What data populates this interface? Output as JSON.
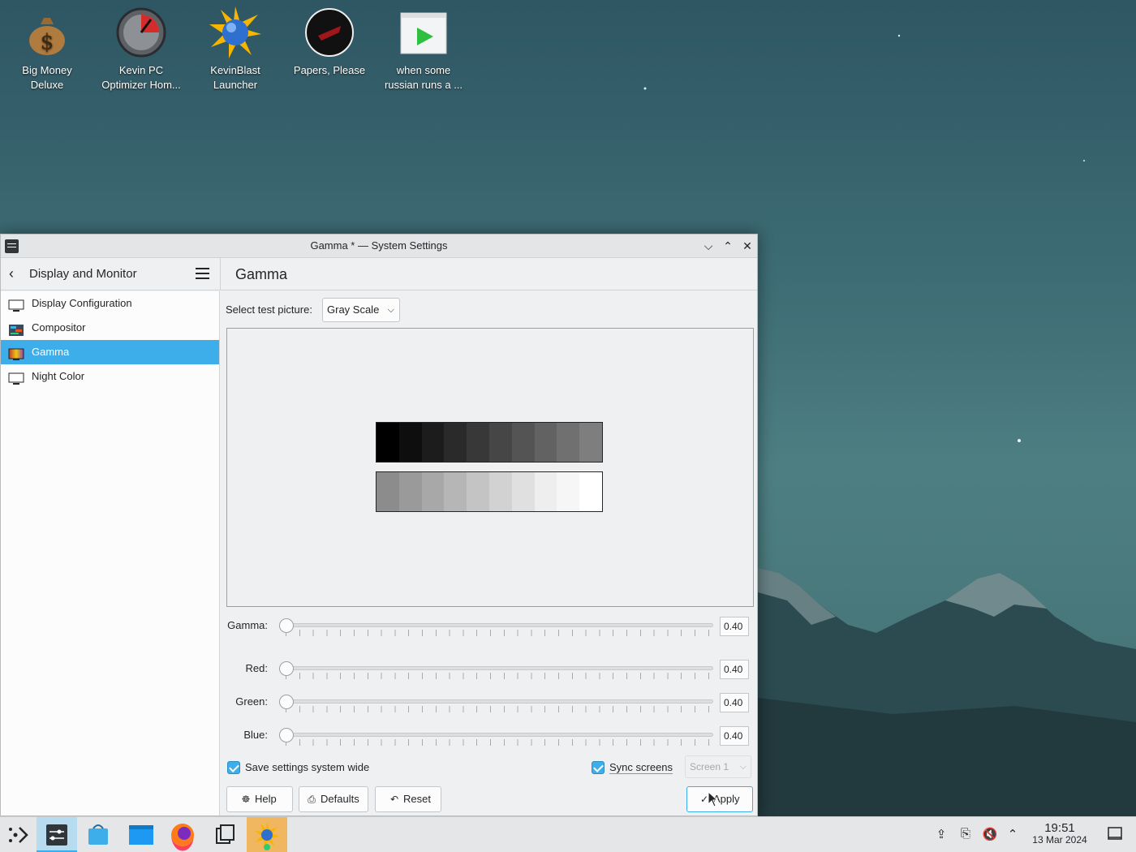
{
  "desktop": {
    "icons": [
      {
        "line1": "Big Money",
        "line2": "Deluxe",
        "icon": "money-bag-icon"
      },
      {
        "line1": "Kevin PC",
        "line2": "Optimizer Hom...",
        "icon": "speedometer-icon"
      },
      {
        "line1": "KevinBlast",
        "line2": "Launcher",
        "icon": "starburst-globe-icon"
      },
      {
        "line1": "Papers, Please",
        "line2": "",
        "icon": "papers-please-icon"
      },
      {
        "line1": "when some",
        "line2": "russian runs a ...",
        "icon": "video-play-icon"
      }
    ]
  },
  "window": {
    "title": "Gamma * — System Settings",
    "header": {
      "breadcrumb": "Display and Monitor",
      "page_title": "Gamma"
    },
    "sidebar": {
      "items": [
        {
          "label": "Display Configuration",
          "icon": "monitor-icon",
          "active": false
        },
        {
          "label": "Compositor",
          "icon": "compositor-icon",
          "active": false
        },
        {
          "label": "Gamma",
          "icon": "gamma-icon",
          "active": true
        },
        {
          "label": "Night Color",
          "icon": "monitor-icon",
          "active": false
        }
      ]
    },
    "test_picture": {
      "label": "Select test picture:",
      "value": "Gray Scale"
    },
    "grayscale": {
      "dark": [
        "#000000",
        "#0e0e0e",
        "#1c1c1c",
        "#2a2a2a",
        "#383838",
        "#464646",
        "#545454",
        "#626262",
        "#707070",
        "#7e7e7e"
      ],
      "light": [
        "#8c8c8c",
        "#9a9a9a",
        "#a8a8a8",
        "#b6b6b6",
        "#c4c4c4",
        "#d2d2d2",
        "#e0e0e0",
        "#eeeeee",
        "#f6f6f6",
        "#ffffff"
      ]
    },
    "sliders": {
      "gamma": {
        "label": "Gamma:",
        "value": "0.40"
      },
      "red": {
        "label": "Red:",
        "value": "0.40"
      },
      "green": {
        "label": "Green:",
        "value": "0.40"
      },
      "blue": {
        "label": "Blue:",
        "value": "0.40"
      }
    },
    "save_system_wide": {
      "label": "Save settings system wide",
      "checked": true
    },
    "sync_screens": {
      "label": "Sync screens",
      "checked": true
    },
    "screen_select": "Screen 1",
    "buttons": {
      "help": "Help",
      "defaults": "Defaults",
      "reset": "Reset",
      "apply": "Apply"
    }
  },
  "taskbar": {
    "clock_time": "19:51",
    "clock_date": "13 Mar 2024"
  },
  "colors": {
    "accent": "#3daee9",
    "window_bg": "#eff0f1"
  }
}
